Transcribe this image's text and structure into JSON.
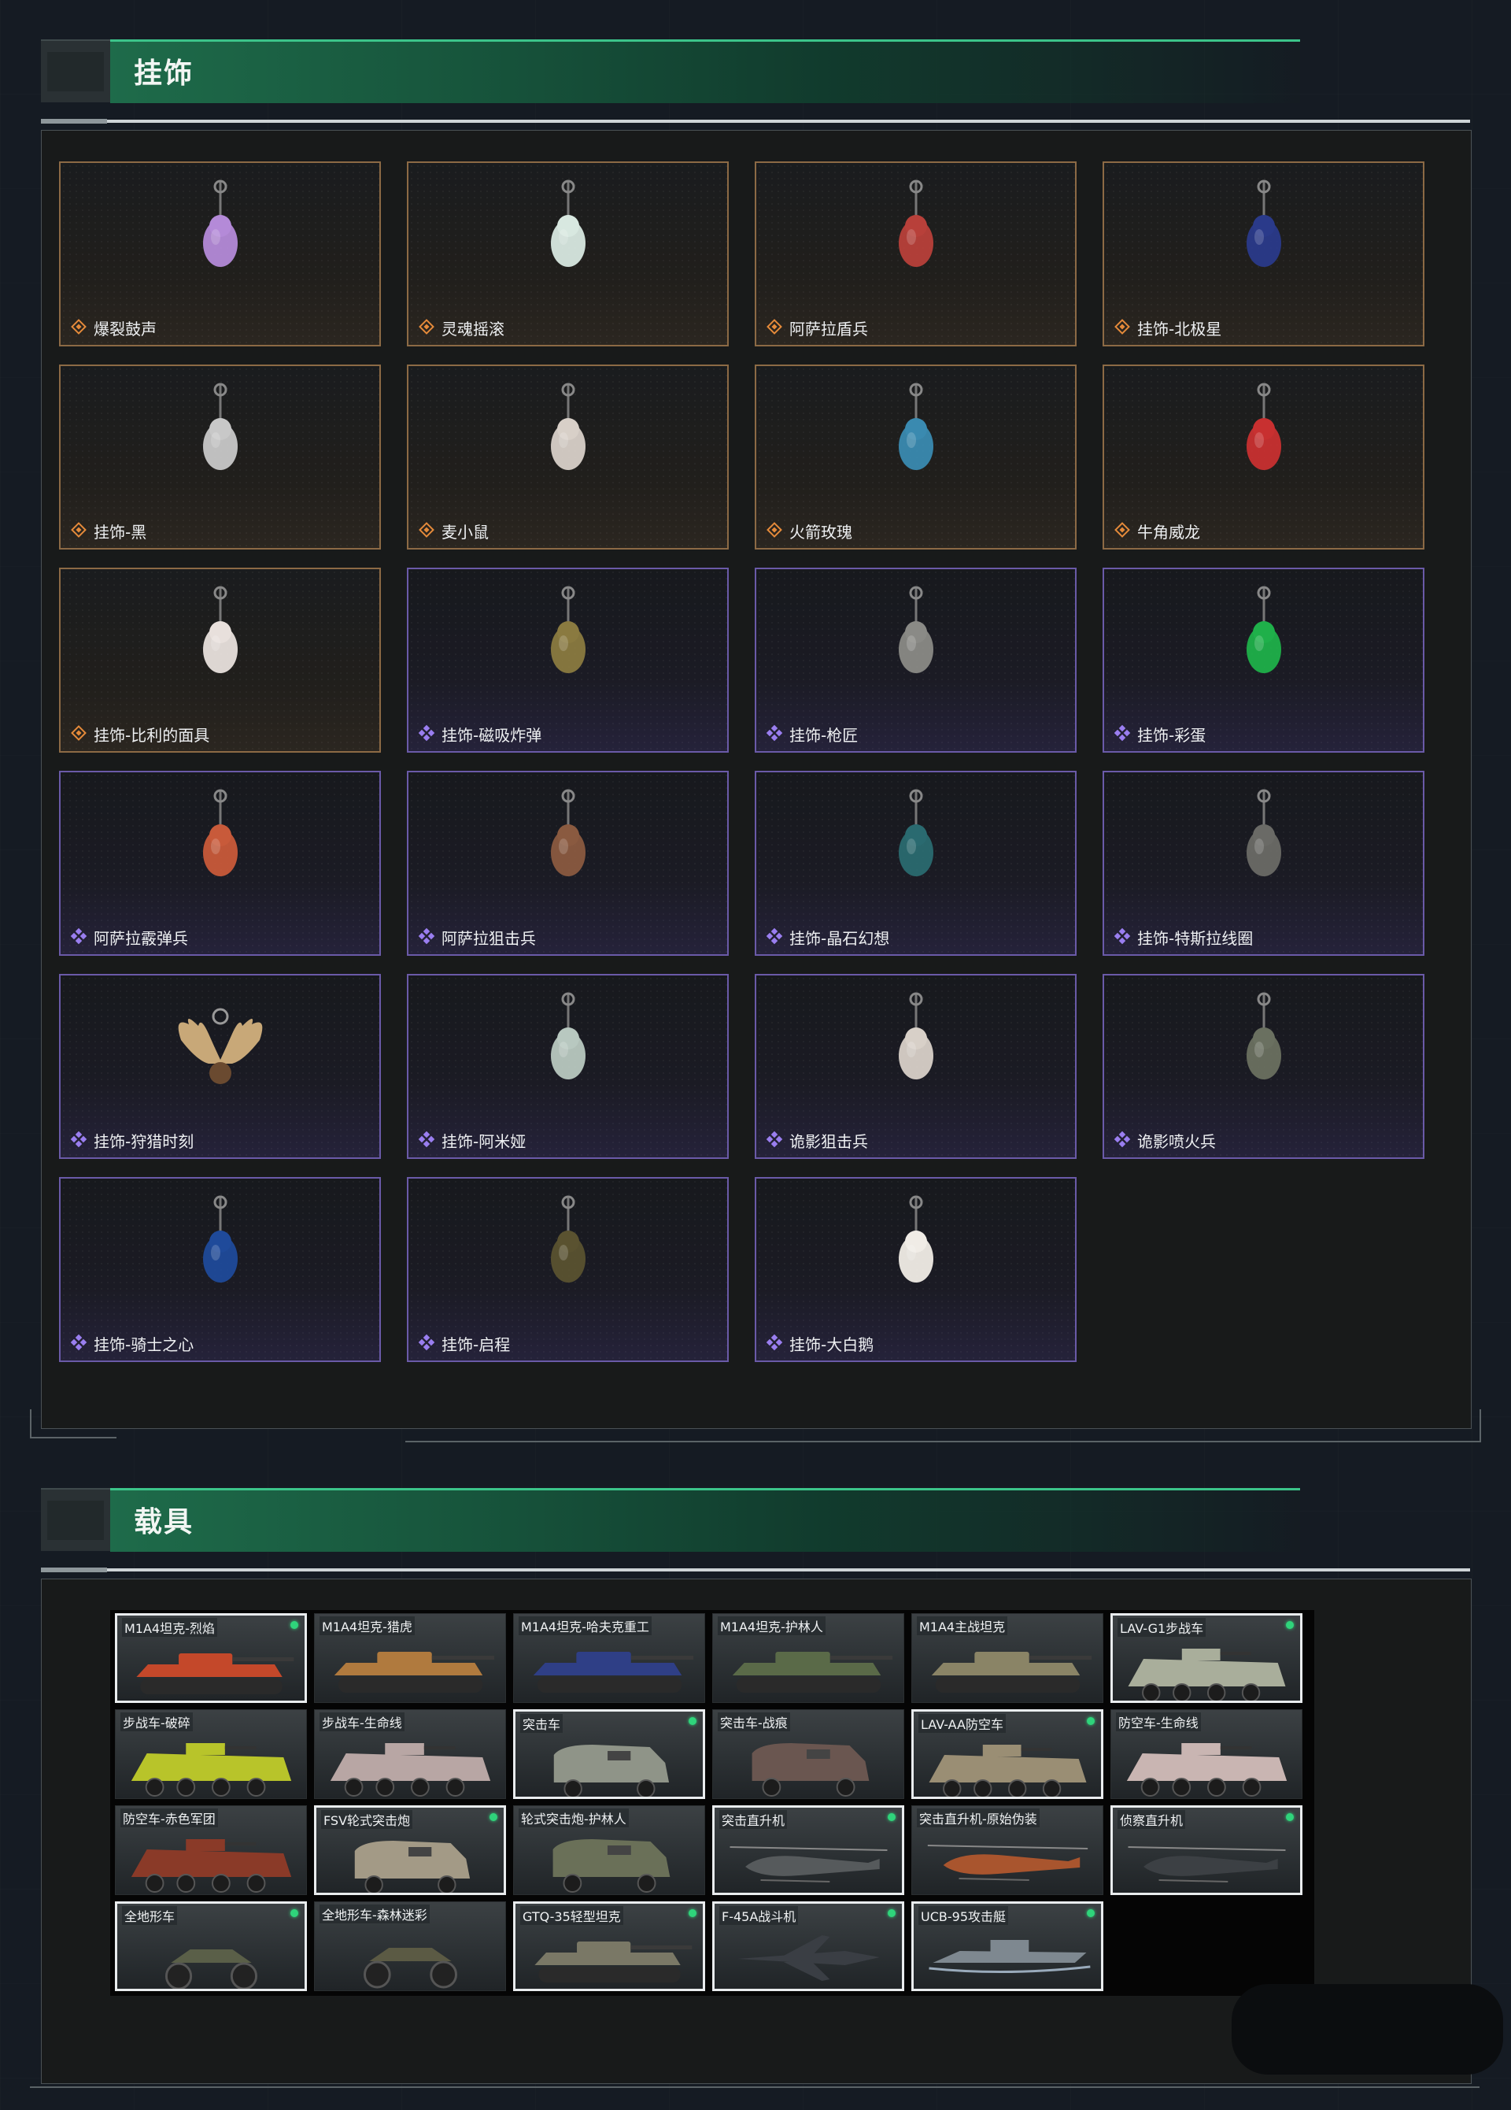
{
  "sections": {
    "pendants_title": "挂饰",
    "vehicles_title": "载具"
  },
  "colors": {
    "accent_green": "#3cc48a",
    "legendary_border": "#8c6a45",
    "epic_border": "#6a5aa8",
    "owned_dot": "#2fd47b"
  },
  "pendants": [
    {
      "name": "爆裂鼓声",
      "rarity": "legendary",
      "icon": "drummer-charm-icon"
    },
    {
      "name": "灵魂摇滚",
      "rarity": "legendary",
      "icon": "guitarist-charm-icon"
    },
    {
      "name": "阿萨拉盾兵",
      "rarity": "legendary",
      "icon": "shield-soldier-charm-icon"
    },
    {
      "name": "挂饰-北极星",
      "rarity": "legendary",
      "icon": "polaris-charm-icon"
    },
    {
      "name": "挂饰-黑",
      "rarity": "legendary",
      "icon": "black-blade-charm-icon"
    },
    {
      "name": "麦小鼠",
      "rarity": "legendary",
      "icon": "mouse-charm-icon"
    },
    {
      "name": "火箭玫瑰",
      "rarity": "legendary",
      "icon": "rocket-rose-charm-icon"
    },
    {
      "name": "牛角威龙",
      "rarity": "legendary",
      "icon": "horned-dragon-charm-icon"
    },
    {
      "name": "挂饰-比利的面具",
      "rarity": "legendary",
      "icon": "billy-mask-charm-icon"
    },
    {
      "name": "挂饰-磁吸炸弹",
      "rarity": "epic",
      "icon": "magnetic-bomb-charm-icon"
    },
    {
      "name": "挂饰-枪匠",
      "rarity": "epic",
      "icon": "gunsmith-case-charm-icon"
    },
    {
      "name": "挂饰-彩蛋",
      "rarity": "epic",
      "icon": "green-egg-charm-icon"
    },
    {
      "name": "阿萨拉霰弹兵",
      "rarity": "epic",
      "icon": "shotgunner-charm-icon"
    },
    {
      "name": "阿萨拉狙击兵",
      "rarity": "epic",
      "icon": "sniper-charm-icon"
    },
    {
      "name": "挂饰-晶石幻想",
      "rarity": "epic",
      "icon": "crystal-cube-charm-icon"
    },
    {
      "name": "挂饰-特斯拉线圈",
      "rarity": "epic",
      "icon": "tesla-coil-charm-icon"
    },
    {
      "name": "挂饰-狩猎时刻",
      "rarity": "epic",
      "icon": "antlers-charm-icon"
    },
    {
      "name": "挂饰-阿米娅",
      "rarity": "epic",
      "icon": "amiya-rabbit-charm-icon"
    },
    {
      "name": "诡影狙击兵",
      "rarity": "epic",
      "icon": "ghost-sniper-charm-icon"
    },
    {
      "name": "诡影喷火兵",
      "rarity": "epic",
      "icon": "ghost-flamer-charm-icon"
    },
    {
      "name": "挂饰-骑士之心",
      "rarity": "epic",
      "icon": "knight-heart-charm-icon"
    },
    {
      "name": "挂饰-启程",
      "rarity": "epic",
      "icon": "departure-badge-charm-icon"
    },
    {
      "name": "挂饰-大白鹅",
      "rarity": "epic",
      "icon": "white-goose-charm-icon"
    }
  ],
  "vehicles": [
    {
      "name": "M1A4坦克-烈焰",
      "owned": true,
      "type": "tank",
      "paint": "#c4482a"
    },
    {
      "name": "M1A4坦克-猎虎",
      "owned": false,
      "type": "tank",
      "paint": "#b07a3e"
    },
    {
      "name": "M1A4坦克-哈夫克重工",
      "owned": false,
      "type": "tank",
      "paint": "#2f3f86"
    },
    {
      "name": "M1A4坦克-护林人",
      "owned": false,
      "type": "tank",
      "paint": "#5a6a48"
    },
    {
      "name": "M1A4主战坦克",
      "owned": false,
      "type": "tank",
      "paint": "#8a8466"
    },
    {
      "name": "LAV-G1步战车",
      "owned": true,
      "type": "ifv",
      "paint": "#a9ae9b"
    },
    {
      "name": "步战车-破碎",
      "owned": false,
      "type": "ifv",
      "paint": "#b8c42a"
    },
    {
      "name": "步战车-生命线",
      "owned": false,
      "type": "ifv",
      "paint": "#b8a6a4"
    },
    {
      "name": "突击车",
      "owned": true,
      "type": "truck",
      "paint": "#8f9488"
    },
    {
      "name": "突击车-战痕",
      "owned": false,
      "type": "truck",
      "paint": "#6a5650"
    },
    {
      "name": "LAV-AA防空车",
      "owned": true,
      "type": "ifv",
      "paint": "#9a8e74"
    },
    {
      "name": "防空车-生命线",
      "owned": false,
      "type": "ifv",
      "paint": "#c9b5b2"
    },
    {
      "name": "防空车-赤色军团",
      "owned": false,
      "type": "ifv",
      "paint": "#8a3a28"
    },
    {
      "name": "FSV轮式突击炮",
      "owned": true,
      "type": "truck",
      "paint": "#a39a86"
    },
    {
      "name": "轮式突击炮-护林人",
      "owned": false,
      "type": "truck",
      "paint": "#6a7058"
    },
    {
      "name": "突击直升机",
      "owned": true,
      "type": "heli",
      "paint": "#565a5c"
    },
    {
      "name": "突击直升机-原始伪装",
      "owned": false,
      "type": "heli",
      "paint": "#a9552e"
    },
    {
      "name": "侦察直升机",
      "owned": true,
      "type": "heli",
      "paint": "#3c4044"
    },
    {
      "name": "全地形车",
      "owned": true,
      "type": "atv",
      "paint": "#5a5f48"
    },
    {
      "name": "全地形车-森林迷彩",
      "owned": false,
      "type": "atv",
      "paint": "#5b5a44"
    },
    {
      "name": "GTQ-35轻型坦克",
      "owned": true,
      "type": "tank",
      "paint": "#7a7866"
    },
    {
      "name": "F-45A战斗机",
      "owned": true,
      "type": "jet",
      "paint": "#3a3e44"
    },
    {
      "name": "UCB-95攻击艇",
      "owned": true,
      "type": "boat",
      "paint": "#7e8890"
    }
  ]
}
